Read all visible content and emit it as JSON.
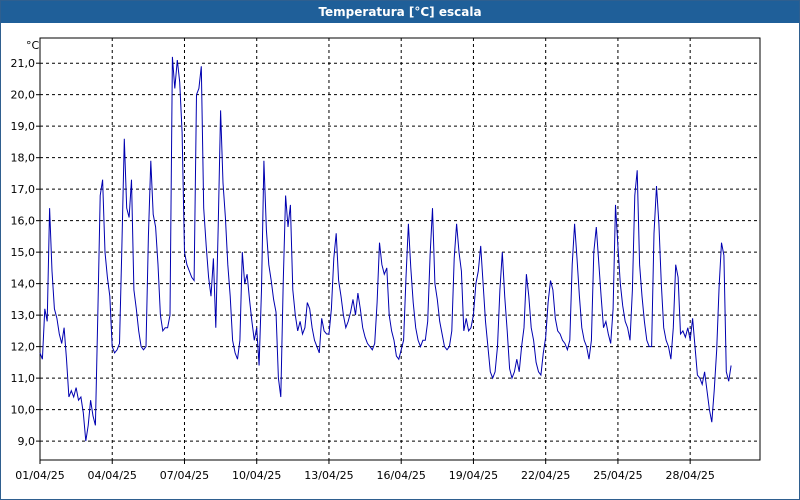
{
  "window": {
    "title": "Temperatura [°C] escala"
  },
  "chart_data": {
    "type": "line",
    "title": "Temperatura [°C] escala",
    "ylabel": "°C",
    "xlabel": "",
    "ylim": [
      8.4,
      21.8
    ],
    "xlim": [
      0,
      29.9
    ],
    "x_origin_date": "2025-04-01",
    "yticks": [
      {
        "value": 9.0,
        "label": "9,0"
      },
      {
        "value": 10.0,
        "label": "10,0"
      },
      {
        "value": 11.0,
        "label": "11,0"
      },
      {
        "value": 12.0,
        "label": "12,0"
      },
      {
        "value": 13.0,
        "label": "13,0"
      },
      {
        "value": 14.0,
        "label": "14,0"
      },
      {
        "value": 15.0,
        "label": "15,0"
      },
      {
        "value": 16.0,
        "label": "16,0"
      },
      {
        "value": 17.0,
        "label": "17,0"
      },
      {
        "value": 18.0,
        "label": "18,0"
      },
      {
        "value": 19.0,
        "label": "19,0"
      },
      {
        "value": 20.0,
        "label": "20,0"
      },
      {
        "value": 21.0,
        "label": "21,0"
      }
    ],
    "xticks": [
      {
        "value": 0,
        "label": "01/04/25"
      },
      {
        "value": 3,
        "label": "04/04/25"
      },
      {
        "value": 6,
        "label": "07/04/25"
      },
      {
        "value": 9,
        "label": "10/04/25"
      },
      {
        "value": 12,
        "label": "13/04/25"
      },
      {
        "value": 15,
        "label": "16/04/25"
      },
      {
        "value": 18,
        "label": "19/04/25"
      },
      {
        "value": 21,
        "label": "22/04/25"
      },
      {
        "value": 24,
        "label": "25/04/25"
      },
      {
        "value": 27,
        "label": "28/04/25"
      }
    ],
    "grid": true,
    "colors": {
      "line": "#0000b0",
      "title_bg": "#1f5f99",
      "grid": "#000000"
    },
    "series": [
      {
        "values": [
          [
            0.0,
            11.8
          ],
          [
            0.1,
            11.6
          ],
          [
            0.2,
            13.2
          ],
          [
            0.3,
            12.8
          ],
          [
            0.4,
            16.4
          ],
          [
            0.5,
            14.4
          ],
          [
            0.6,
            13.2
          ],
          [
            0.7,
            12.9
          ],
          [
            0.8,
            12.4
          ],
          [
            0.9,
            12.1
          ],
          [
            1.0,
            12.6
          ],
          [
            1.1,
            11.6
          ],
          [
            1.2,
            10.4
          ],
          [
            1.3,
            10.6
          ],
          [
            1.4,
            10.4
          ],
          [
            1.5,
            10.7
          ],
          [
            1.6,
            10.3
          ],
          [
            1.7,
            10.4
          ],
          [
            1.8,
            9.9
          ],
          [
            1.9,
            9.0
          ],
          [
            2.0,
            9.5
          ],
          [
            2.1,
            10.3
          ],
          [
            2.2,
            9.8
          ],
          [
            2.3,
            9.5
          ],
          [
            2.4,
            13.0
          ],
          [
            2.5,
            16.8
          ],
          [
            2.6,
            17.3
          ],
          [
            2.7,
            15.0
          ],
          [
            2.8,
            14.2
          ],
          [
            2.9,
            13.6
          ],
          [
            3.0,
            12.0
          ],
          [
            3.1,
            11.8
          ],
          [
            3.2,
            11.9
          ],
          [
            3.3,
            12.1
          ],
          [
            3.4,
            15.2
          ],
          [
            3.5,
            18.6
          ],
          [
            3.6,
            16.4
          ],
          [
            3.7,
            16.1
          ],
          [
            3.8,
            17.3
          ],
          [
            3.9,
            13.8
          ],
          [
            4.0,
            13.2
          ],
          [
            4.1,
            12.5
          ],
          [
            4.2,
            12.0
          ],
          [
            4.3,
            11.9
          ],
          [
            4.4,
            12.0
          ],
          [
            4.5,
            15.5
          ],
          [
            4.6,
            17.9
          ],
          [
            4.7,
            16.2
          ],
          [
            4.8,
            15.8
          ],
          [
            4.9,
            14.6
          ],
          [
            5.0,
            13.0
          ],
          [
            5.1,
            12.5
          ],
          [
            5.2,
            12.6
          ],
          [
            5.3,
            12.6
          ],
          [
            5.4,
            13.0
          ],
          [
            5.5,
            21.2
          ],
          [
            5.6,
            20.2
          ],
          [
            5.7,
            21.1
          ],
          [
            5.8,
            20.4
          ],
          [
            5.9,
            18.8
          ],
          [
            6.0,
            15.0
          ],
          [
            6.1,
            14.6
          ],
          [
            6.2,
            14.4
          ],
          [
            6.3,
            14.2
          ],
          [
            6.4,
            14.1
          ],
          [
            6.5,
            20.0
          ],
          [
            6.6,
            20.2
          ],
          [
            6.7,
            20.9
          ],
          [
            6.8,
            16.4
          ],
          [
            6.9,
            15.2
          ],
          [
            7.0,
            14.2
          ],
          [
            7.1,
            13.6
          ],
          [
            7.2,
            14.8
          ],
          [
            7.3,
            12.6
          ],
          [
            7.4,
            15.8
          ],
          [
            7.5,
            19.5
          ],
          [
            7.6,
            17.2
          ],
          [
            7.7,
            16.1
          ],
          [
            7.8,
            14.6
          ],
          [
            7.9,
            13.6
          ],
          [
            8.0,
            12.2
          ],
          [
            8.1,
            11.8
          ],
          [
            8.2,
            11.6
          ],
          [
            8.3,
            12.2
          ],
          [
            8.4,
            15.0
          ],
          [
            8.5,
            14.0
          ],
          [
            8.6,
            14.3
          ],
          [
            8.7,
            13.5
          ],
          [
            8.8,
            12.8
          ],
          [
            8.9,
            12.2
          ],
          [
            9.0,
            12.6
          ],
          [
            9.1,
            11.4
          ],
          [
            9.2,
            13.8
          ],
          [
            9.3,
            17.9
          ],
          [
            9.4,
            15.7
          ],
          [
            9.5,
            14.6
          ],
          [
            9.6,
            14.1
          ],
          [
            9.7,
            13.5
          ],
          [
            9.8,
            13.1
          ],
          [
            9.9,
            11.0
          ],
          [
            10.0,
            10.4
          ],
          [
            10.1,
            14.0
          ],
          [
            10.2,
            16.8
          ],
          [
            10.3,
            15.8
          ],
          [
            10.4,
            16.5
          ],
          [
            10.5,
            13.8
          ],
          [
            10.6,
            13.0
          ],
          [
            10.7,
            12.5
          ],
          [
            10.8,
            12.8
          ],
          [
            10.9,
            12.4
          ],
          [
            11.0,
            12.6
          ],
          [
            11.1,
            13.4
          ],
          [
            11.2,
            13.2
          ],
          [
            11.3,
            12.6
          ],
          [
            11.4,
            12.2
          ],
          [
            11.5,
            12.0
          ],
          [
            11.6,
            11.8
          ],
          [
            11.7,
            12.9
          ],
          [
            11.8,
            12.5
          ],
          [
            11.9,
            12.4
          ],
          [
            12.0,
            12.4
          ],
          [
            12.1,
            13.2
          ],
          [
            12.2,
            14.8
          ],
          [
            12.3,
            15.6
          ],
          [
            12.4,
            14.1
          ],
          [
            12.5,
            13.6
          ],
          [
            12.6,
            13.0
          ],
          [
            12.7,
            12.6
          ],
          [
            12.8,
            12.8
          ],
          [
            12.9,
            13.1
          ],
          [
            13.0,
            13.5
          ],
          [
            13.1,
            13.0
          ],
          [
            13.2,
            13.7
          ],
          [
            13.3,
            13.2
          ],
          [
            13.4,
            12.6
          ],
          [
            13.5,
            12.3
          ],
          [
            13.6,
            12.1
          ],
          [
            13.7,
            12.0
          ],
          [
            13.8,
            11.9
          ],
          [
            13.9,
            12.1
          ],
          [
            14.0,
            13.4
          ],
          [
            14.1,
            15.3
          ],
          [
            14.2,
            14.6
          ],
          [
            14.3,
            14.3
          ],
          [
            14.4,
            14.5
          ],
          [
            14.5,
            13.0
          ],
          [
            14.6,
            12.5
          ],
          [
            14.7,
            12.2
          ],
          [
            14.8,
            11.7
          ],
          [
            14.9,
            11.6
          ],
          [
            15.0,
            11.9
          ],
          [
            15.1,
            12.2
          ],
          [
            15.2,
            14.2
          ],
          [
            15.3,
            15.9
          ],
          [
            15.4,
            14.5
          ],
          [
            15.5,
            13.4
          ],
          [
            15.6,
            12.6
          ],
          [
            15.7,
            12.2
          ],
          [
            15.8,
            12.0
          ],
          [
            15.9,
            12.2
          ],
          [
            16.0,
            12.2
          ],
          [
            16.1,
            12.8
          ],
          [
            16.2,
            14.9
          ],
          [
            16.3,
            16.4
          ],
          [
            16.4,
            14.0
          ],
          [
            16.5,
            13.5
          ],
          [
            16.6,
            12.8
          ],
          [
            16.7,
            12.4
          ],
          [
            16.8,
            12.0
          ],
          [
            16.9,
            11.9
          ],
          [
            17.0,
            12.0
          ],
          [
            17.1,
            12.5
          ],
          [
            17.2,
            14.8
          ],
          [
            17.3,
            15.9
          ],
          [
            17.4,
            15.0
          ],
          [
            17.5,
            14.4
          ],
          [
            17.6,
            12.5
          ],
          [
            17.7,
            12.9
          ],
          [
            17.8,
            12.5
          ],
          [
            17.9,
            12.6
          ],
          [
            18.0,
            13.0
          ],
          [
            18.1,
            14.0
          ],
          [
            18.2,
            14.4
          ],
          [
            18.3,
            15.2
          ],
          [
            18.4,
            14.0
          ],
          [
            18.5,
            12.8
          ],
          [
            18.6,
            12.0
          ],
          [
            18.7,
            11.2
          ],
          [
            18.8,
            11.0
          ],
          [
            18.9,
            11.2
          ],
          [
            19.0,
            12.0
          ],
          [
            19.1,
            13.8
          ],
          [
            19.2,
            15.0
          ],
          [
            19.3,
            13.6
          ],
          [
            19.4,
            12.5
          ],
          [
            19.5,
            11.3
          ],
          [
            19.6,
            11.0
          ],
          [
            19.7,
            11.2
          ],
          [
            19.8,
            11.6
          ],
          [
            19.9,
            11.2
          ],
          [
            20.0,
            12.0
          ],
          [
            20.1,
            12.6
          ],
          [
            20.2,
            14.3
          ],
          [
            20.3,
            13.6
          ],
          [
            20.4,
            12.6
          ],
          [
            20.5,
            12.2
          ],
          [
            20.6,
            11.5
          ],
          [
            20.7,
            11.2
          ],
          [
            20.8,
            11.1
          ],
          [
            20.9,
            11.8
          ],
          [
            21.0,
            12.3
          ],
          [
            21.1,
            13.4
          ],
          [
            21.2,
            14.1
          ],
          [
            21.3,
            13.8
          ],
          [
            21.4,
            12.9
          ],
          [
            21.5,
            12.5
          ],
          [
            21.6,
            12.4
          ],
          [
            21.7,
            12.2
          ],
          [
            21.8,
            12.1
          ],
          [
            21.9,
            11.9
          ],
          [
            22.0,
            12.2
          ],
          [
            22.1,
            14.6
          ],
          [
            22.2,
            15.9
          ],
          [
            22.3,
            14.8
          ],
          [
            22.4,
            13.6
          ],
          [
            22.5,
            12.6
          ],
          [
            22.6,
            12.2
          ],
          [
            22.7,
            12.0
          ],
          [
            22.8,
            11.6
          ],
          [
            22.9,
            12.2
          ],
          [
            23.0,
            15.0
          ],
          [
            23.1,
            15.8
          ],
          [
            23.2,
            14.7
          ],
          [
            23.3,
            13.6
          ],
          [
            23.4,
            12.6
          ],
          [
            23.5,
            12.8
          ],
          [
            23.6,
            12.4
          ],
          [
            23.7,
            12.1
          ],
          [
            23.8,
            13.2
          ],
          [
            23.9,
            16.5
          ],
          [
            24.0,
            15.2
          ],
          [
            24.1,
            14.0
          ],
          [
            24.2,
            13.3
          ],
          [
            24.3,
            12.8
          ],
          [
            24.4,
            12.6
          ],
          [
            24.5,
            12.2
          ],
          [
            24.6,
            13.8
          ],
          [
            24.7,
            16.8
          ],
          [
            24.8,
            17.6
          ],
          [
            24.9,
            14.6
          ],
          [
            25.0,
            13.6
          ],
          [
            25.1,
            12.8
          ],
          [
            25.2,
            12.2
          ],
          [
            25.3,
            12.0
          ],
          [
            25.4,
            12.0
          ],
          [
            25.5,
            15.6
          ],
          [
            25.6,
            17.1
          ],
          [
            25.7,
            15.9
          ],
          [
            25.8,
            14.0
          ],
          [
            25.9,
            12.6
          ],
          [
            26.0,
            12.2
          ],
          [
            26.1,
            12.0
          ],
          [
            26.2,
            11.6
          ],
          [
            26.3,
            12.6
          ],
          [
            26.4,
            14.6
          ],
          [
            26.5,
            14.2
          ],
          [
            26.6,
            12.4
          ],
          [
            26.7,
            12.5
          ],
          [
            26.8,
            12.3
          ],
          [
            26.9,
            12.6
          ],
          [
            27.0,
            12.2
          ],
          [
            27.1,
            12.9
          ],
          [
            27.2,
            12.0
          ],
          [
            27.3,
            11.1
          ],
          [
            27.4,
            11.0
          ],
          [
            27.5,
            10.8
          ],
          [
            27.6,
            11.2
          ],
          [
            27.7,
            10.6
          ],
          [
            27.8,
            10.0
          ],
          [
            27.9,
            9.6
          ],
          [
            28.0,
            10.6
          ],
          [
            28.1,
            11.9
          ],
          [
            28.2,
            13.9
          ],
          [
            28.3,
            15.3
          ],
          [
            28.4,
            14.9
          ],
          [
            28.5,
            11.2
          ],
          [
            28.6,
            10.9
          ],
          [
            28.7,
            11.4
          ]
        ]
      }
    ]
  }
}
